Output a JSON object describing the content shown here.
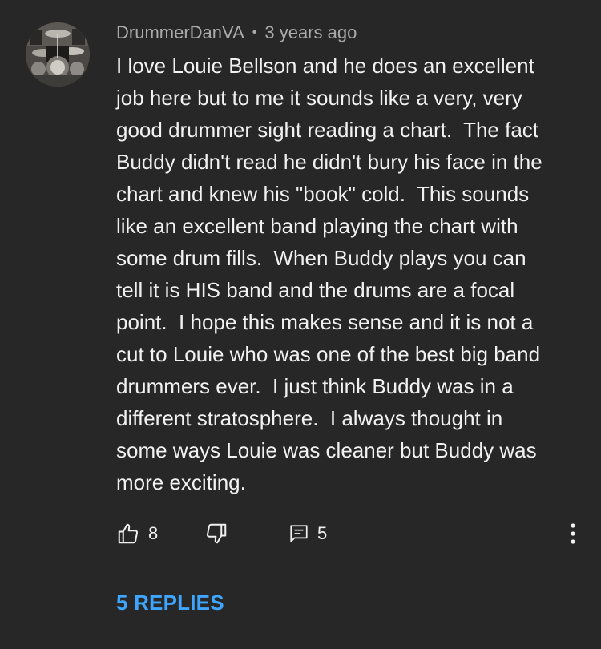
{
  "comment": {
    "author": "DrummerDanVA",
    "separator": "•",
    "time": "3 years ago",
    "text": "I love Louie Bellson and he does an excellent\njob here but to me it sounds like a very, very\ngood drummer sight reading a chart.  The fact\nBuddy didn't read he didn't bury his face in the\nchart and knew his \"book\" cold.  This sounds\nlike an excellent band playing the chart with\nsome drum fills.  When Buddy plays you can\ntell it is HIS band and the drums are a focal\npoint.  I hope this makes sense and it is not a\ncut to Louie who was one of the best big band\ndrummers ever.  I just think Buddy was in a\ndifferent stratosphere.  I always thought in\nsome ways Louie was cleaner but Buddy was\nmore exciting.",
    "likes": "8",
    "reply_count": "5",
    "replies_label": "5 REPLIES"
  },
  "icons": {
    "like": "thumb-up-icon",
    "dislike": "thumb-down-icon",
    "reply": "comment-icon",
    "more": "more-vertical-icon"
  },
  "colors": {
    "background": "#272727",
    "text": "#f1f1f1",
    "secondary": "#aaaaaa",
    "link": "#3ea6ff"
  }
}
